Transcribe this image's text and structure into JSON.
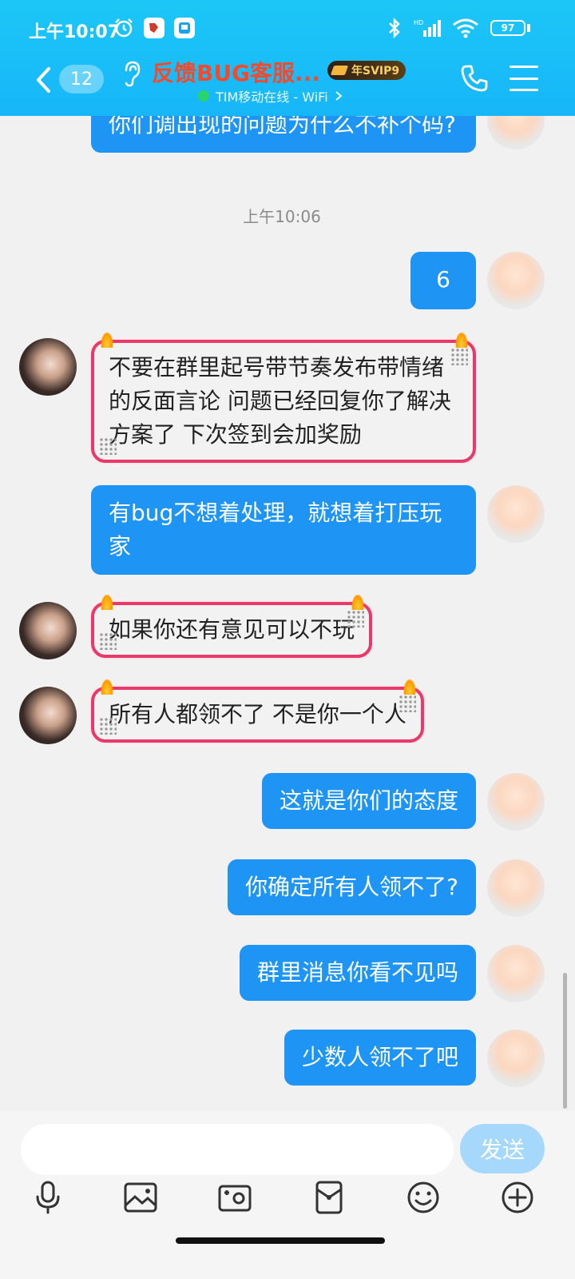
{
  "status_bar": {
    "time": "上午10:07",
    "battery": "97"
  },
  "header": {
    "unread_count": "12",
    "title": "反馈BUG客服...",
    "svip_badge": "年SVIP9",
    "subtitle": "TIM移动在线 - WiFi",
    "colors": {
      "header_bg": "#17b6f8",
      "title": "#f44a2c"
    }
  },
  "chat": {
    "timestamp": "上午10:06",
    "messages": [
      {
        "sender": "self",
        "text": "你们调出现的问题为什么不补个码?"
      },
      {
        "sender": "self",
        "text": "6"
      },
      {
        "sender": "other",
        "text": "不要在群里起号带节奏发布带情绪的反面言论 问题已经回复你了解决方案了 下次签到会加奖励"
      },
      {
        "sender": "self",
        "text": "有bug不想着处理，就想着打压玩家"
      },
      {
        "sender": "other",
        "text": "如果你还有意见可以不玩"
      },
      {
        "sender": "other",
        "text": "所有人都领不了 不是你一个人"
      },
      {
        "sender": "self",
        "text": "这就是你们的态度"
      },
      {
        "sender": "self",
        "text": "你确定所有人领不了?"
      },
      {
        "sender": "self",
        "text": "群里消息你看不见吗"
      },
      {
        "sender": "self",
        "text": "少数人领不了吧"
      }
    ],
    "colors": {
      "self_bubble": "#1e95f5",
      "other_border": "#e83a6a"
    }
  },
  "input": {
    "value": "",
    "send_label": "发送"
  },
  "toolbar": {
    "icons": [
      "microphone-icon",
      "image-icon",
      "camera-icon",
      "red-packet-icon",
      "emoji-icon",
      "plus-icon"
    ]
  }
}
